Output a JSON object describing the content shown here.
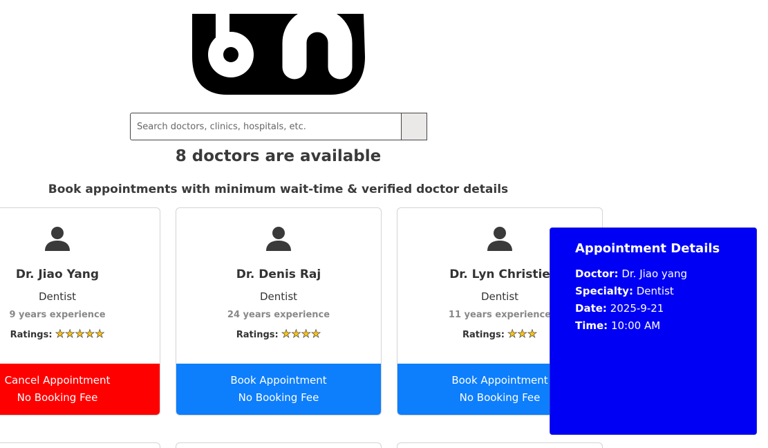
{
  "search": {
    "placeholder": "Search doctors, clinics, hospitals, etc."
  },
  "heading": "8 doctors are available",
  "subheading": "Book appointments with minimum wait-time & verified doctor details",
  "rating_label": "Ratings:",
  "doctors": [
    {
      "name": "Dr. Jiao Yang",
      "specialty": "Dentist",
      "experience": "9 years experience",
      "rating": 5,
      "stars": "★★★★★",
      "button_line1": "Cancel Appointment",
      "button_line2": "No Booking Fee",
      "button_color": "#ff0000"
    },
    {
      "name": "Dr. Denis Raj",
      "specialty": "Dentist",
      "experience": "24 years experience",
      "rating": 4,
      "stars": "★★★★",
      "button_line1": "Book Appointment",
      "button_line2": "No Booking Fee",
      "button_color": "#0d7efc"
    },
    {
      "name": "Dr. Lyn Christie",
      "specialty": "Dentist",
      "experience": "11 years experience",
      "rating": 3,
      "stars": "★★★",
      "button_line1": "Book Appointment",
      "button_line2": "No Booking Fee",
      "button_color": "#0d7efc"
    }
  ],
  "popup": {
    "title": "Appointment Details",
    "doctor_label": "Doctor:",
    "doctor_value": "Dr. Jiao yang",
    "specialty_label": "Specialty:",
    "specialty_value": "Dentist",
    "date_label": "Date:",
    "date_value": "2025-9-21",
    "time_label": "Time:",
    "time_value": "10:00 AM",
    "background_color": "#0000f5"
  },
  "icons": {
    "logo": "stethoscope-logo-icon",
    "avatar": "user-avatar-icon",
    "star": "star-icon"
  }
}
